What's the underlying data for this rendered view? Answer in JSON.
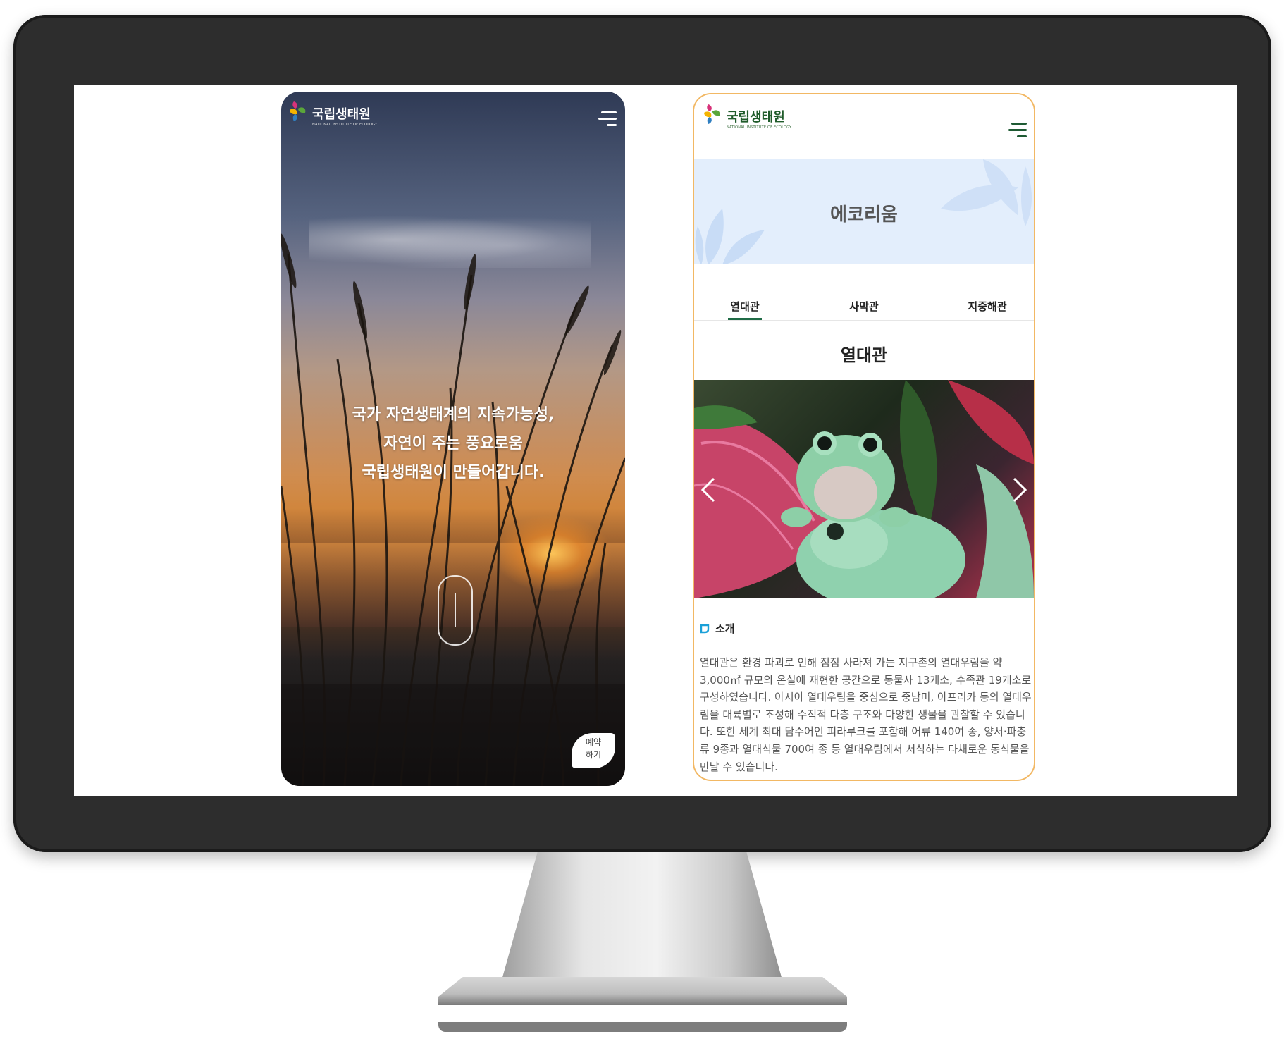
{
  "phone1": {
    "logo_ko": "국립생태원",
    "logo_en": "NATIONAL INSTITUTE OF ECOLOGY",
    "hero_lines": [
      "국가 자연생태계의 지속가능성,",
      "자연이 주는 풍요로움",
      "국립생태원이 만들어갑니다."
    ],
    "reserve_line1": "예약",
    "reserve_line2": "하기"
  },
  "phone2": {
    "logo_ko": "국립생태원",
    "logo_en": "NATIONAL INSTITUTE OF ECOLOGY",
    "banner_title": "에코리움",
    "tabs": [
      {
        "label": "열대관",
        "active": true
      },
      {
        "label": "사막관",
        "active": false
      },
      {
        "label": "지중해관",
        "active": false
      }
    ],
    "section_title": "열대관",
    "intro_label": "소개",
    "intro_text": "열대관은 환경 파괴로 인해 점점 사라져 가는 지구촌의 열대우림을 약 3,000㎡ 규모의 온실에 재현한 공간으로 동물사 13개소, 수족관 19개소로 구성하였습니다. 아시아 열대우림을 중심으로 중남미, 아프리카 등의 열대우림을 대륙별로 조성해 수직적 다층 구조와 다양한 생물을 관찰할 수 있습니다. 또한 세계 최대 담수어인 피라루크를 포함해 어류 140여 종, 양서·파충류 9종과 열대식물 700여 종 등 열대우림에서 서식하는 다채로운 동식물을 만날 수 있습니다."
  },
  "colors": {
    "monitor_frame": "#2d2d2d",
    "phone2_border": "#f2b864",
    "brand_green": "#1f5b2a",
    "banner_bg": "#e3eefc",
    "tab_underline": "#1f6b46"
  }
}
